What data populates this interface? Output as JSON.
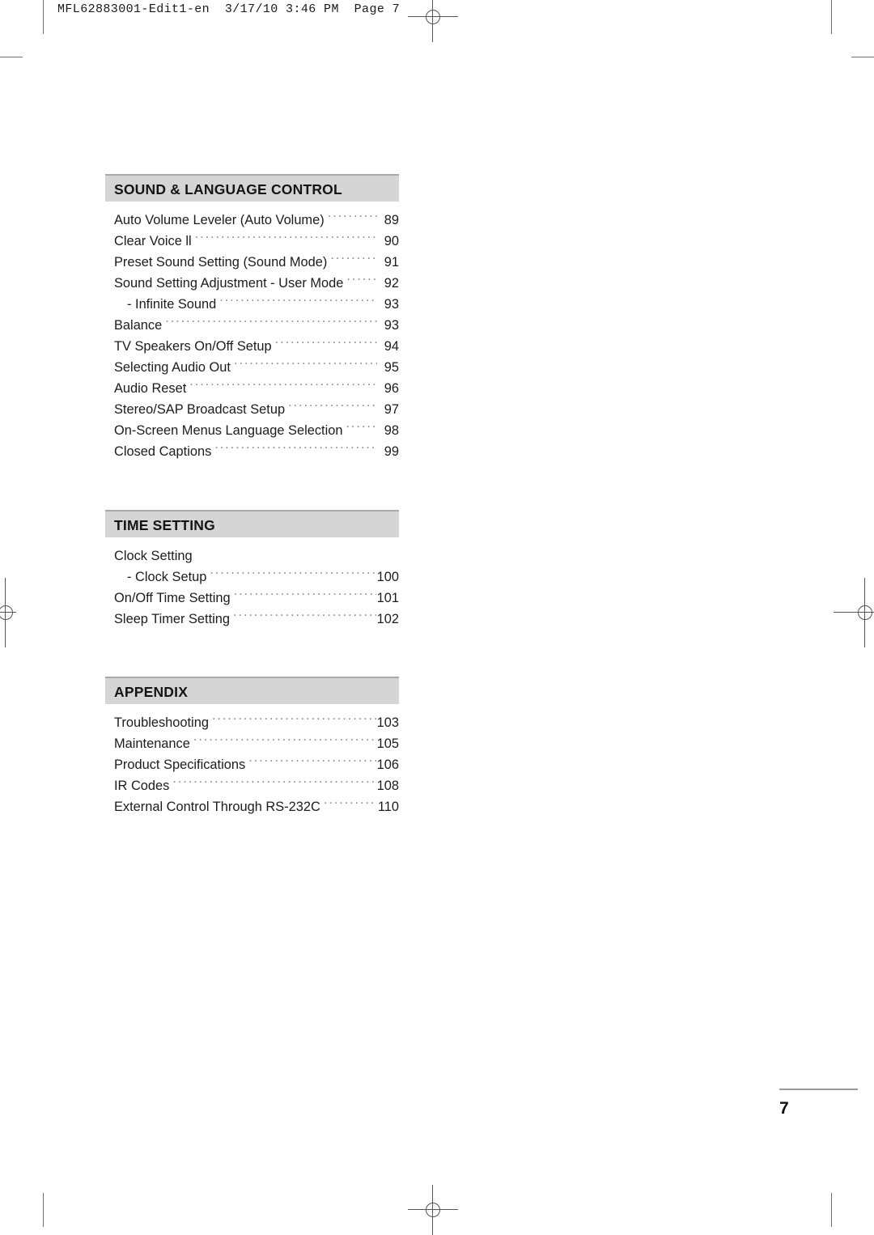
{
  "header": {
    "slug": "MFL62883001-Edit1-en  3/17/10 3:46 PM  Page 7"
  },
  "folio": {
    "page_number": "7"
  },
  "toc": {
    "sections": [
      {
        "title": "SOUND & LANGUAGE CONTROL",
        "entries": [
          {
            "label": "Auto Volume Leveler (Auto Volume)",
            "page": "89",
            "sub": false
          },
          {
            "label": "Clear Voice ll",
            "page": "90",
            "sub": false
          },
          {
            "label": "Preset Sound Setting (Sound Mode)",
            "page": "91",
            "sub": false
          },
          {
            "label": "Sound Setting Adjustment - User Mode",
            "page": "92",
            "sub": false
          },
          {
            "label": "- Infinite Sound",
            "page": "93",
            "sub": true
          },
          {
            "label": "Balance",
            "page": "93",
            "sub": false
          },
          {
            "label": "TV Speakers On/Off Setup",
            "page": "94",
            "sub": false
          },
          {
            "label": "Selecting Audio Out",
            "page": "95",
            "sub": false
          },
          {
            "label": "Audio Reset ",
            "page": "96",
            "sub": false
          },
          {
            "label": "Stereo/SAP Broadcast Setup",
            "page": "97",
            "sub": false
          },
          {
            "label": "On-Screen Menus Language Selection",
            "page": "98",
            "sub": false
          },
          {
            "label": "Closed Captions",
            "page": "99",
            "sub": false
          }
        ]
      },
      {
        "title": "TIME SETTING",
        "entries": [
          {
            "label": "Clock Setting",
            "page": "",
            "sub": false,
            "nodots": true
          },
          {
            "label": "- Clock Setup",
            "page": "100",
            "sub": true
          },
          {
            "label": "On/Off Time Setting",
            "page": "101",
            "sub": false
          },
          {
            "label": "Sleep Timer Setting",
            "page": "102",
            "sub": false
          }
        ]
      },
      {
        "title": "APPENDIX",
        "entries": [
          {
            "label": "Troubleshooting",
            "page": "103",
            "sub": false
          },
          {
            "label": "Maintenance",
            "page": "105",
            "sub": false
          },
          {
            "label": "Product Specifications",
            "page": "106",
            "sub": false
          },
          {
            "label": "IR Codes  ",
            "page": "108",
            "sub": false
          },
          {
            "label": "External Control Through RS-232C",
            "page": "110",
            "sub": false
          }
        ]
      }
    ]
  },
  "colors": {
    "section_bar": "#d5d5d5",
    "section_bar_top_rule": "#a9a9a9",
    "text": "#1c1c1c",
    "leader_dots": "#8e8e8e"
  }
}
